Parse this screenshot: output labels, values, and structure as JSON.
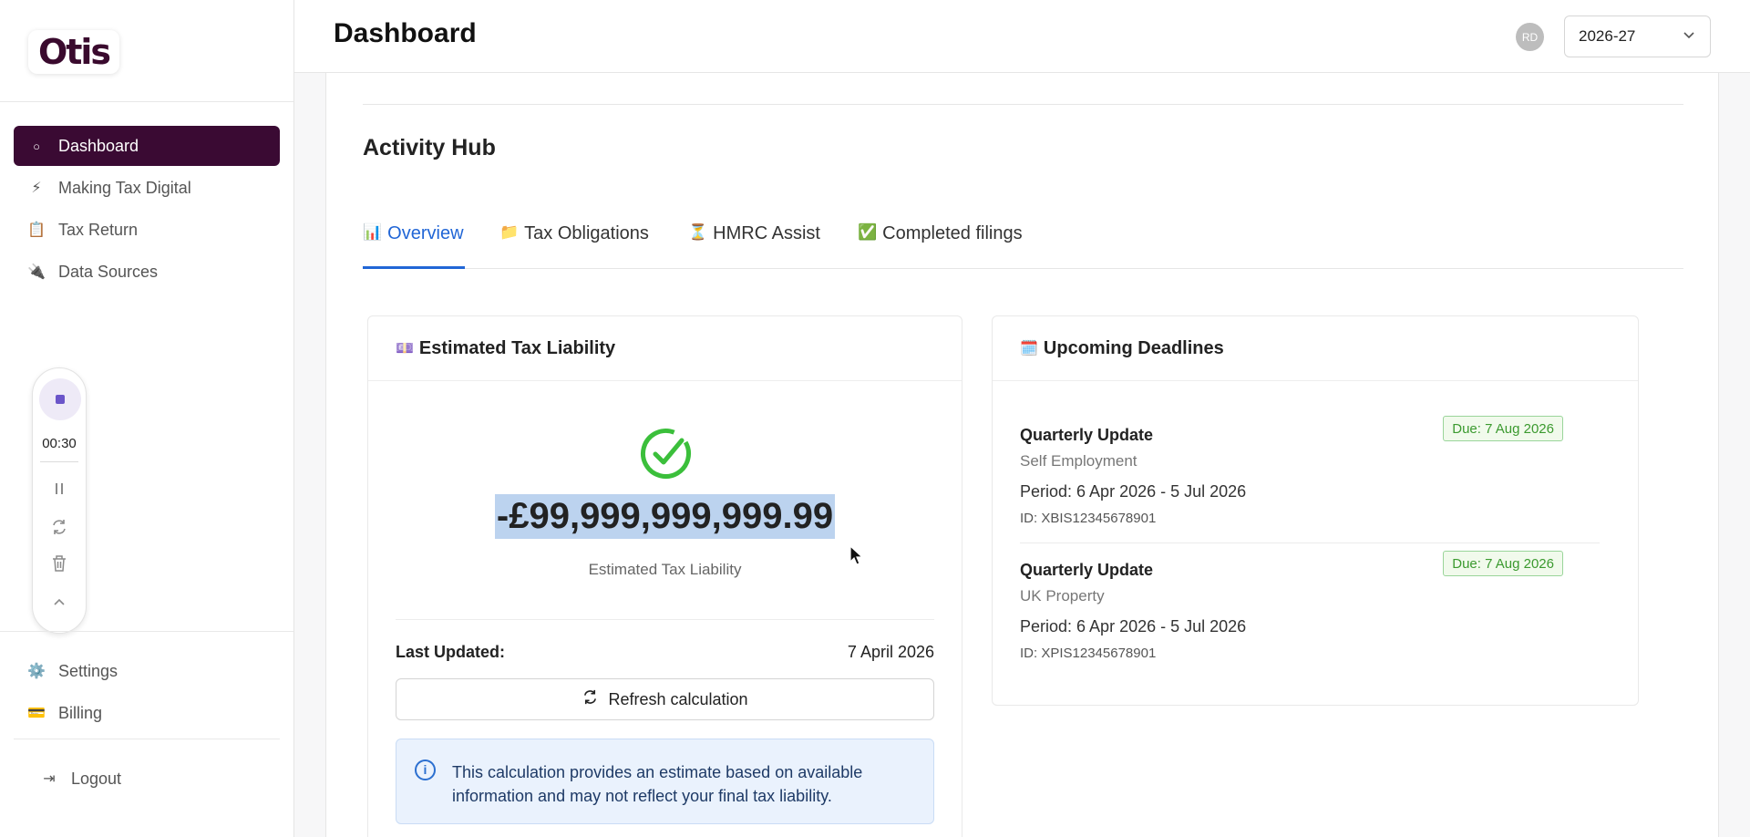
{
  "app": {
    "logo": "Otis"
  },
  "sidebar": {
    "items": [
      {
        "label": "Dashboard",
        "icon": "○",
        "active": true
      },
      {
        "label": "Making Tax Digital",
        "icon": "⚡"
      },
      {
        "label": "Tax Return",
        "icon": "📋"
      },
      {
        "label": "Data Sources",
        "icon": "🔌"
      }
    ],
    "bottom_items": [
      {
        "label": "Settings",
        "icon": "⚙️"
      },
      {
        "label": "Billing",
        "icon": "💳"
      }
    ],
    "logout": {
      "label": "Logout",
      "icon": "⇥"
    }
  },
  "recorder": {
    "time": "00:30"
  },
  "header": {
    "title": "Dashboard",
    "avatar_initials": "RD",
    "year": "2026-27"
  },
  "hub": {
    "title": "Activity Hub",
    "tabs": [
      {
        "label": "Overview",
        "icon": "📊"
      },
      {
        "label": "Tax Obligations",
        "icon": "📁"
      },
      {
        "label": "HMRC Assist",
        "icon": "⏳"
      },
      {
        "label": "Completed filings",
        "icon": "✅"
      }
    ]
  },
  "liability": {
    "title": "Estimated Tax Liability",
    "icon": "💷",
    "amount": "-£99,999,999,999.99",
    "amount_label": "Estimated Tax Liability",
    "last_updated_label": "Last Updated:",
    "last_updated_value": "7 April 2026",
    "refresh_label": "Refresh calculation",
    "info_text": "This calculation provides an estimate based on available information and may not reflect your final tax liability."
  },
  "deadlines": {
    "title": "Upcoming Deadlines",
    "icon": "🗓️",
    "items": [
      {
        "title": "Quarterly Update",
        "subtitle": "Self Employment",
        "period": "Period: 6 Apr 2026 - 5 Jul 2026",
        "id": "ID: XBIS12345678901",
        "due": "Due: 7 Aug 2026"
      },
      {
        "title": "Quarterly Update",
        "subtitle": "UK Property",
        "period": "Period: 6 Apr 2026 - 5 Jul 2026",
        "id": "ID: XPIS12345678901",
        "due": "Due: 7 Aug 2026"
      }
    ]
  },
  "colors": {
    "brand": "#3a0a33",
    "accent": "#2166d6",
    "success": "#3bbf3b"
  }
}
